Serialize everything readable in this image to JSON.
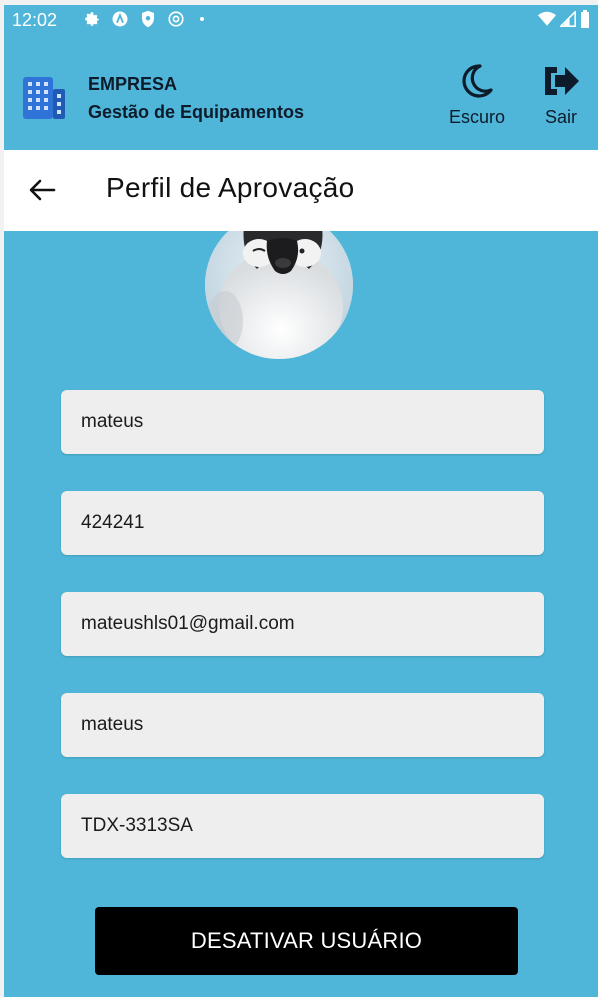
{
  "status_bar": {
    "time": "12:02",
    "icons": [
      "gear-icon",
      "a-badge-icon",
      "shield-icon",
      "at-sign-icon"
    ],
    "right_icons": [
      "wifi-icon",
      "signal-icon",
      "battery-icon"
    ]
  },
  "header": {
    "company": "EMPRESA",
    "subtitle": "Gestão de Equipamentos",
    "dark_label": "Escuro",
    "exit_label": "Sair"
  },
  "page": {
    "title": "Perfil de Aprovação"
  },
  "form": {
    "name": "mateus",
    "code": "424241",
    "email": "mateushls01@gmail.com",
    "username": "mateus",
    "device_id": "TDX-3313SA"
  },
  "actions": {
    "deactivate_label": "DESATIVAR USUÁRIO"
  },
  "colors": {
    "background": "#4fb6d9",
    "title_bar": "#ffffff",
    "field": "#eeeeee",
    "button": "#000000",
    "logo": "#2f73d9"
  }
}
